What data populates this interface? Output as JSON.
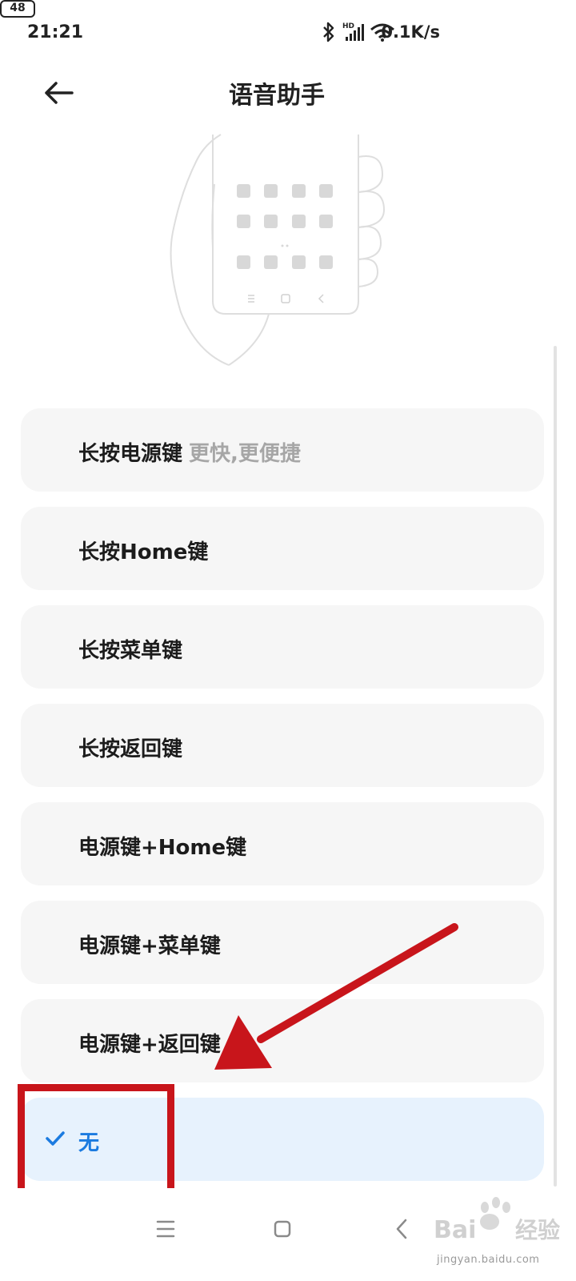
{
  "status_bar": {
    "time": "21:21",
    "network_speed": "0.1K/s",
    "battery": "48",
    "icons": [
      "bluetooth-icon",
      "hd-signal-icon",
      "wifi-icon",
      "battery-icon"
    ]
  },
  "header": {
    "title": "语音助手",
    "back_icon": "arrow-left-icon"
  },
  "illustration": {
    "description_icon": "hand-holding-phone-illustration"
  },
  "options": [
    {
      "label": "长按电源键",
      "hint": "更快,更便捷",
      "selected": false
    },
    {
      "label": "长按Home键",
      "hint": "",
      "selected": false
    },
    {
      "label": "长按菜单键",
      "hint": "",
      "selected": false
    },
    {
      "label": "长按返回键",
      "hint": "",
      "selected": false
    },
    {
      "label": "电源键+Home键",
      "hint": "",
      "selected": false
    },
    {
      "label": "电源键+菜单键",
      "hint": "",
      "selected": false
    },
    {
      "label": "电源键+返回键",
      "hint": "",
      "selected": false
    },
    {
      "label": "无",
      "hint": "",
      "selected": true
    }
  ],
  "nav_bar": {
    "icons": [
      "menu-icon",
      "home-icon",
      "back-icon"
    ]
  },
  "annotation": {
    "color": "#c8151b"
  },
  "watermark": {
    "text": "jingyan.baidu.com"
  },
  "colors": {
    "accent": "#1b7be0",
    "selected_bg": "#e7f2fd",
    "option_bg": "#f6f6f6",
    "hint": "#a6a6a6"
  }
}
